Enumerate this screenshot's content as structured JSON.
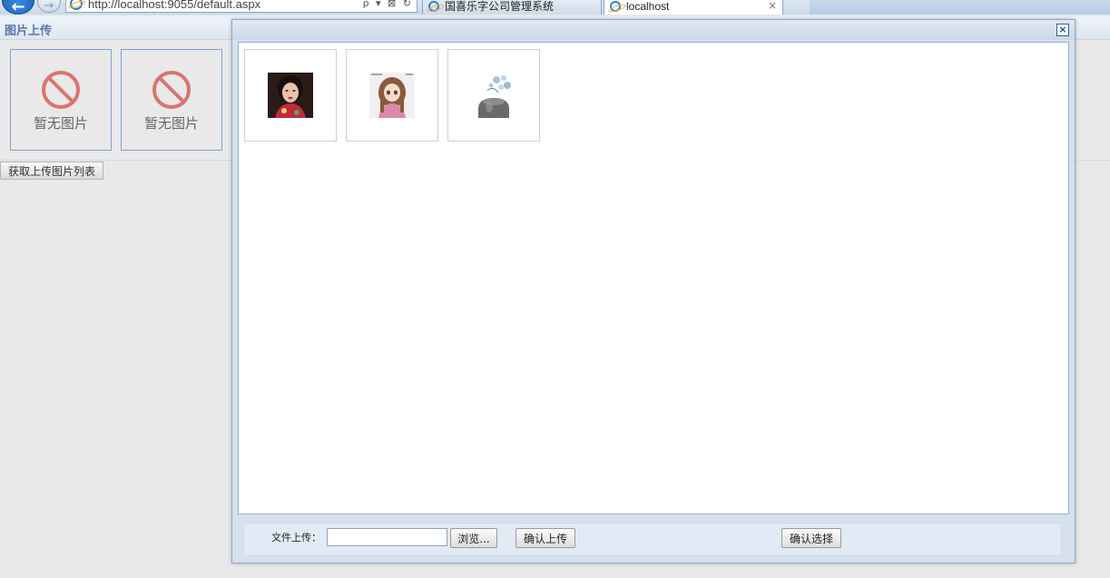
{
  "browser": {
    "address": "http://localhost:9055/default.aspx",
    "tabs": [
      {
        "label": "国喜乐字公司管理系统",
        "active": false
      },
      {
        "label": "localhost",
        "active": true
      }
    ],
    "tab_close_glyph": "×",
    "back_glyph": "←",
    "forward_glyph": "→",
    "addr_tools": "ρ ▾ ⊠ ↻"
  },
  "page": {
    "title": "图片上传",
    "placeholders": [
      {
        "text": "暂无图片",
        "icon": "no-entry-icon"
      },
      {
        "text": "暂无图片",
        "icon": "no-entry-icon"
      }
    ],
    "get_list_button": "获取上传图片列表"
  },
  "dialog": {
    "close_glyph": "×",
    "images": [
      {
        "desc": "woman-in-red-qipao"
      },
      {
        "desc": "anime-girl-pink-dress"
      },
      {
        "desc": "ink-vase-with-blossoms"
      }
    ],
    "footer": {
      "upload_label": "文件上传：",
      "file_value": "",
      "browse_button": "浏览...",
      "confirm_upload_button": "确认上传",
      "confirm_select_button": "确认选择"
    }
  },
  "colors": {
    "accent": "#5878a8",
    "no_image_icon": "#d9756f",
    "dialog_bg": "#d6e1ef"
  }
}
